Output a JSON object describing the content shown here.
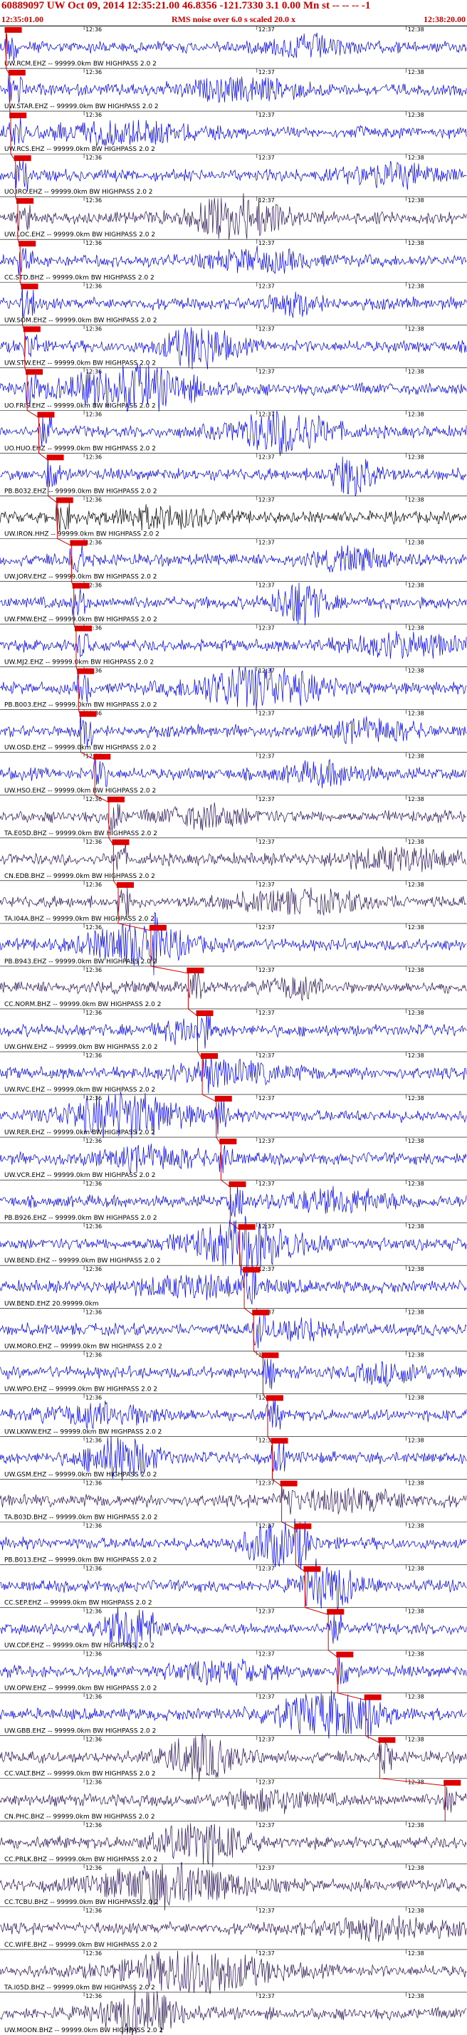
{
  "header": {
    "title": "60889097 UW Oct 09, 2014 12:35:21.00   46.8356 -121.7330  3.1 0.00 Mn st -- -- -- -1",
    "subtitle": "RMS noise over 6.0 s scaled 20.0 x",
    "start_time": "12:35:01.00",
    "end_time": "12:38:20.00"
  },
  "colors": {
    "trace_blue": "#0000ee",
    "trace_dark": "#2a1458",
    "trace_black": "#000000",
    "pick_red": "#dd0000",
    "grid": "#000000"
  },
  "tick_labels": [
    "12:36",
    "12:37",
    "12:38"
  ],
  "traces": [
    {
      "label": "UW.RCM.EHZ -- 99999.0km BW HIGHPASS 2.0 2",
      "color": "blue",
      "pick": 0.01
    },
    {
      "label": "UW.STAR.EHZ -- 99999.0km BW HIGHPASS 2.0 2",
      "color": "blue",
      "pick": 0.018
    },
    {
      "label": "UW.RCS.EHZ -- 99999.0km BW HIGHPASS 2.0 2",
      "color": "blue",
      "pick": 0.02
    },
    {
      "label": "UO.IRO.EHZ -- 99999.0km BW HIGHPASS 2.0 2",
      "color": "blue",
      "pick": 0.03
    },
    {
      "label": "UW.LOC.EHZ -- 99999.0km BW HIGHPASS 2.0 2",
      "color": "dark",
      "pick": 0.035
    },
    {
      "label": "CC.STD.BHZ -- 99999.0km BW HIGHPASS 2.0 2",
      "color": "blue",
      "pick": 0.04
    },
    {
      "label": "UW.SOM.EHZ -- 99999.0km BW HIGHPASS 2.0 2",
      "color": "blue",
      "pick": 0.045
    },
    {
      "label": "UW.STW.EHZ -- 99999.0km BW HIGHPASS 2.0 2",
      "color": "blue",
      "pick": 0.05
    },
    {
      "label": "UO.FRIS.EHZ -- 99999.0km BW HIGHPASS 2.0 2",
      "color": "blue",
      "pick": 0.055
    },
    {
      "label": "UO.HUO.EHZ -- 99999.0km BW HIGHPASS 2.0 2",
      "color": "blue",
      "pick": 0.08
    },
    {
      "label": "PB.B032.EHZ -- 99999.0km BW HIGHPASS 2.0 2",
      "color": "blue",
      "pick": 0.1
    },
    {
      "label": "UW.IRON.HHZ -- 99999.0km BW HIGHPASS 2.0 2",
      "color": "black",
      "pick": 0.12
    },
    {
      "label": "UW.JORV.EHZ -- 99999.0km BW HIGHPASS 2.0 2",
      "color": "blue",
      "pick": 0.15
    },
    {
      "label": "UW.FMW.EHZ -- 99999.0km BW HIGHPASS 2.0 2",
      "color": "blue",
      "pick": 0.155
    },
    {
      "label": "UW.MJ2.EHZ -- 99999.0km BW HIGHPASS 2.0 2",
      "color": "blue",
      "pick": 0.16
    },
    {
      "label": "PB.B003.EHZ -- 99999.0km BW HIGHPASS 2.0 2",
      "color": "blue",
      "pick": 0.165
    },
    {
      "label": "UW.OSD.EHZ -- 99999.0km BW HIGHPASS 2.0 2",
      "color": "blue",
      "pick": 0.17
    },
    {
      "label": "UW.HSO.EHZ -- 99999.0km BW HIGHPASS 2.0 2",
      "color": "blue",
      "pick": 0.2
    },
    {
      "label": "TA.E05D.BHZ -- 99999.0km BW HIGHPASS 2.0 2",
      "color": "dark",
      "pick": 0.23
    },
    {
      "label": "CN.EDB.BHZ -- 99999.0km BW HIGHPASS 2.0 2",
      "color": "dark",
      "pick": 0.24
    },
    {
      "label": "TA.I04A.BHZ -- 99999.0km BW HIGHPASS 2.0 2",
      "color": "dark",
      "pick": 0.25
    },
    {
      "label": "PB.B943.EHZ -- 99999.0km BW HIGHPASS 2.0 2",
      "color": "blue",
      "pick": 0.32
    },
    {
      "label": "CC.NORM.BHZ -- 99999.0km BW HIGHPASS 2.0 2",
      "color": "dark",
      "pick": 0.4
    },
    {
      "label": "UW.GHW.EHZ -- 99999.0km BW HIGHPASS 2.0 2",
      "color": "blue",
      "pick": 0.42
    },
    {
      "label": "UW.RVC.EHZ -- 99999.0km BW HIGHPASS 2.0 2",
      "color": "blue",
      "pick": 0.43
    },
    {
      "label": "UW.RER.EHZ -- 99999.0km BW HIGHPASS 2.0 2",
      "color": "blue",
      "pick": 0.46
    },
    {
      "label": "UW.VCR.EHZ -- 99999.0km BW HIGHPASS 2.0 2",
      "color": "blue",
      "pick": 0.47
    },
    {
      "label": "PB.B926.EHZ -- 99999.0km BW HIGHPASS 2.0 2",
      "color": "blue",
      "pick": 0.49
    },
    {
      "label": "UW.BEND.EHZ -- 99999.0km BW HIGHPASS 2.0 2",
      "color": "blue",
      "pick": 0.51
    },
    {
      "label": "UW.BEND.EHZ 20.99999.0km",
      "color": "blue",
      "pick": 0.52
    },
    {
      "label": "UW.MORO.EHZ -- 99999.0km BW HIGHPASS 2.0 2",
      "color": "blue",
      "pick": 0.54
    },
    {
      "label": "UW.WPO.EHZ -- 99999.0km BW HIGHPASS 2.0 2",
      "color": "blue",
      "pick": 0.56
    },
    {
      "label": "UW.LKWW.EHZ -- 99999.0km BW HIGHPASS 2.0 2",
      "color": "blue",
      "pick": 0.57
    },
    {
      "label": "UW.GSM.EHZ -- 99999.0km BW HIGHPASS 2.0 2",
      "color": "blue",
      "pick": 0.58
    },
    {
      "label": "TA.B03D.BHZ -- 99999.0km BW HIGHPASS 2.0 2",
      "color": "dark",
      "pick": 0.6
    },
    {
      "label": "PB.B013.EHZ -- 99999.0km BW HIGHPASS 2.0 2",
      "color": "blue",
      "pick": 0.63
    },
    {
      "label": "CC.SEP.EHZ -- 99999.0km BW HIGHPASS 2.0 2",
      "color": "blue",
      "pick": 0.65
    },
    {
      "label": "UW.CDF.EHZ -- 99999.0km BW HIGHPASS 2.0 2",
      "color": "blue",
      "pick": 0.7
    },
    {
      "label": "UW.OPW.EHZ -- 99999.0km BW HIGHPASS 2.0 2",
      "color": "blue",
      "pick": 0.72
    },
    {
      "label": "UW.GBB.EHZ -- 99999.0km BW HIGHPASS 2.0 2",
      "color": "blue",
      "pick": 0.78
    },
    {
      "label": "CC.VALT.BHZ -- 99999.0km BW HIGHPASS 2.0 2",
      "color": "dark",
      "pick": 0.81
    },
    {
      "label": "CN.PHC.BHZ -- 99999.0km BW HIGHPASS 2.0 2",
      "color": "dark",
      "pick": 0.95
    },
    {
      "label": "CC.PRLK.BHZ -- 99999.0km BW HIGHPASS 2.0 2",
      "color": "dark",
      "pick": null
    },
    {
      "label": "CC.TCBU.BHZ -- 99999.0km BW HIGHPASS 2.0 2",
      "color": "dark",
      "pick": null
    },
    {
      "label": "CC.WIFE.BHZ -- 99999.0km BW HIGHPASS 2.0 2",
      "color": "dark",
      "pick": null
    },
    {
      "label": "TA.I05D.BHZ -- 99999.0km BW HIGHPASS 2.0 2",
      "color": "dark",
      "pick": null
    },
    {
      "label": "UW.MOON.BHZ -- 99999.0km BW HIGHPASS 2.0 2",
      "color": "dark",
      "pick": null
    }
  ]
}
